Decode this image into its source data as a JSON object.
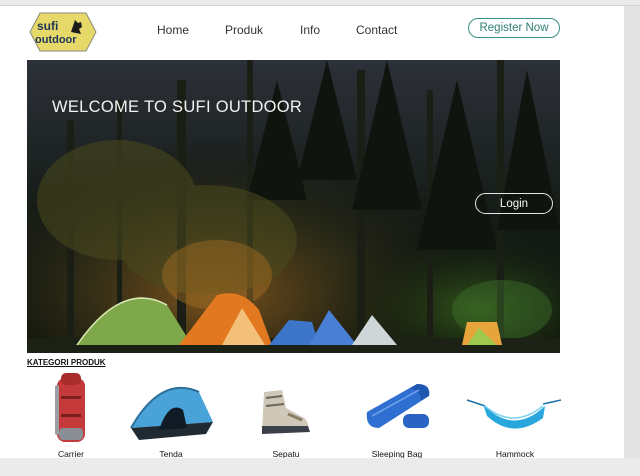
{
  "logo": {
    "line1": "sufi",
    "line2": "outdoor"
  },
  "nav": {
    "items": [
      "Home",
      "Produk",
      "Info",
      "Contact"
    ]
  },
  "register_label": "Register Now",
  "hero": {
    "title": "WELCOME TO SUFI OUTDOOR",
    "login_label": "Login"
  },
  "kategori": {
    "title": "KATEGORI PRODUK",
    "items": [
      "Carrier",
      "Tenda",
      "Sepatu",
      "Sleeping Bag",
      "Hammock"
    ]
  },
  "colors": {
    "accent": "#3a8f86",
    "logo_yellow": "#e6d96a",
    "hero_bg": "#0e1410"
  }
}
